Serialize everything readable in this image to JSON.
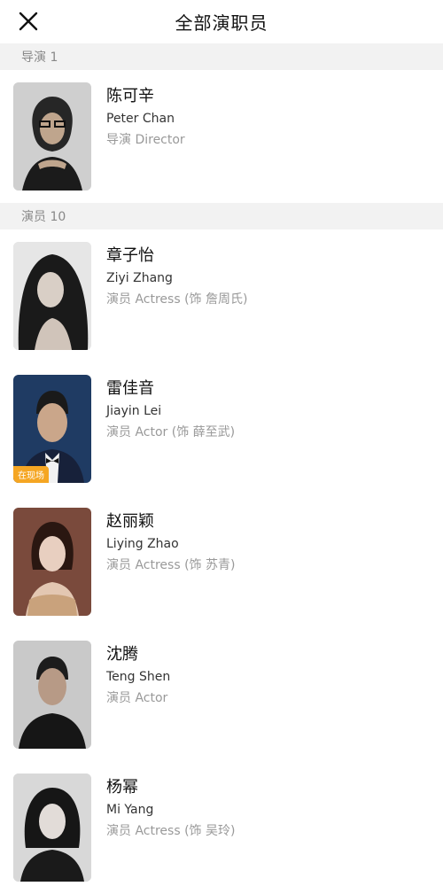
{
  "header": {
    "title": "全部演职员"
  },
  "directors_section": {
    "label": "导演 1"
  },
  "director": {
    "name_cn": "陈可辛",
    "name_en": "Peter Chan",
    "role": "导演 Director"
  },
  "actors_section": {
    "label": "演员 10"
  },
  "actors": [
    {
      "name_cn": "章子怡",
      "name_en": "Ziyi Zhang",
      "role": "演员 Actress (饰 詹周氏)"
    },
    {
      "name_cn": "雷佳音",
      "name_en": "Jiayin Lei",
      "role": "演员 Actor (饰 薛至武)",
      "badge": "在现场"
    },
    {
      "name_cn": "赵丽颖",
      "name_en": "Liying Zhao",
      "role": "演员 Actress (饰 苏青)"
    },
    {
      "name_cn": "沈腾",
      "name_en": "Teng Shen",
      "role": "演员 Actor"
    },
    {
      "name_cn": "杨幂",
      "name_en": "Mi Yang",
      "role": "演员 Actress (饰 吴玲)"
    }
  ]
}
